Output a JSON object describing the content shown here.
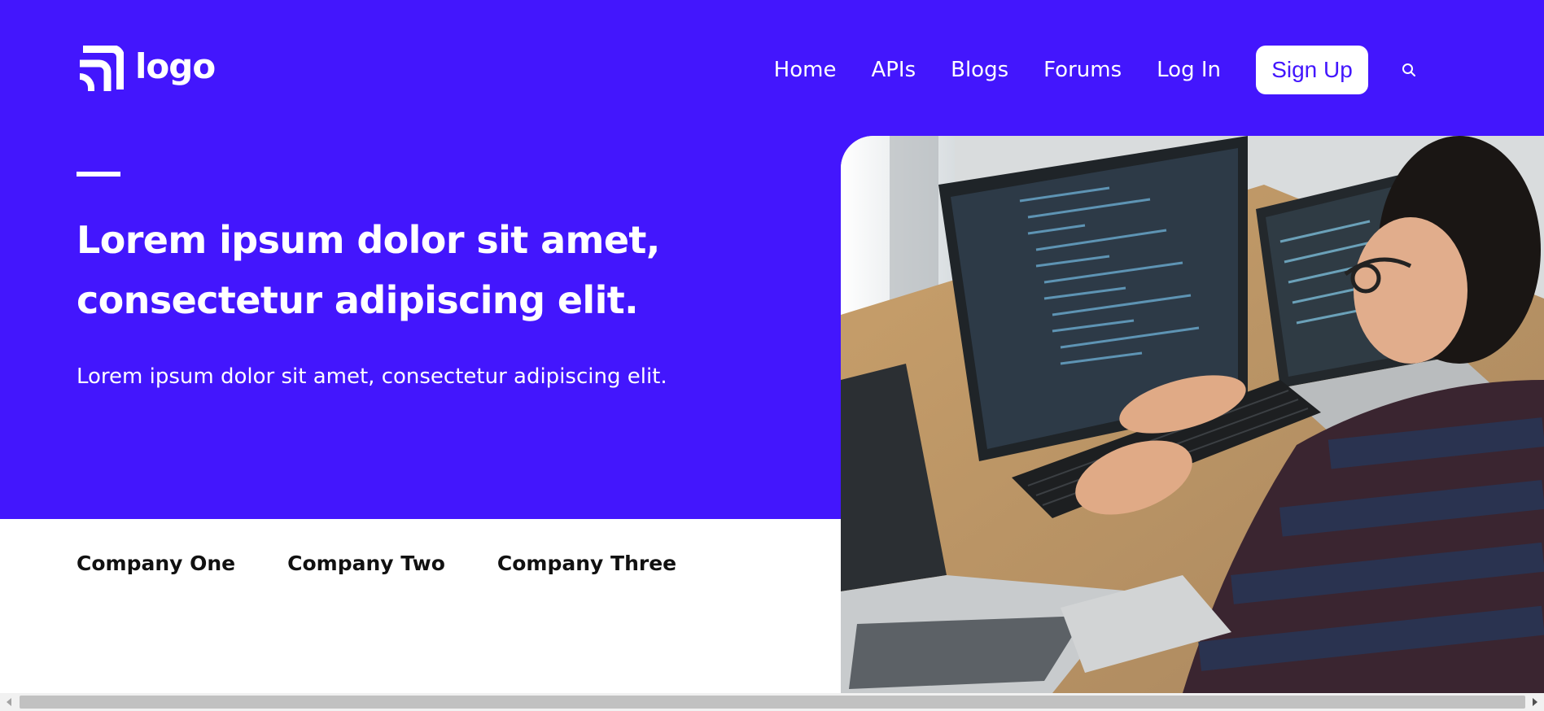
{
  "brand": {
    "logo_text": "logo",
    "logo_icon": "signal-arcs-icon"
  },
  "colors": {
    "primary": "#4316fd",
    "white": "#ffffff",
    "text_dark": "#111111"
  },
  "nav": {
    "links": [
      {
        "label": "Home"
      },
      {
        "label": "APIs"
      },
      {
        "label": "Blogs"
      },
      {
        "label": "Forums"
      },
      {
        "label": "Log In"
      }
    ],
    "signup_label": "Sign Up",
    "search_icon": "search-icon"
  },
  "hero": {
    "headline": "Lorem ipsum dolor sit amet, consectetur adipiscing elit.",
    "subtext": "Lorem ipsum dolor sit amet, consectetur adipiscing elit.",
    "image_subject": "developer-at-computer-image"
  },
  "companies": [
    {
      "name": "Company One"
    },
    {
      "name": "Company Two"
    },
    {
      "name": "Company Three"
    }
  ],
  "scrollbar": {
    "left_icon": "scroll-left-icon",
    "right_icon": "scroll-right-icon"
  }
}
